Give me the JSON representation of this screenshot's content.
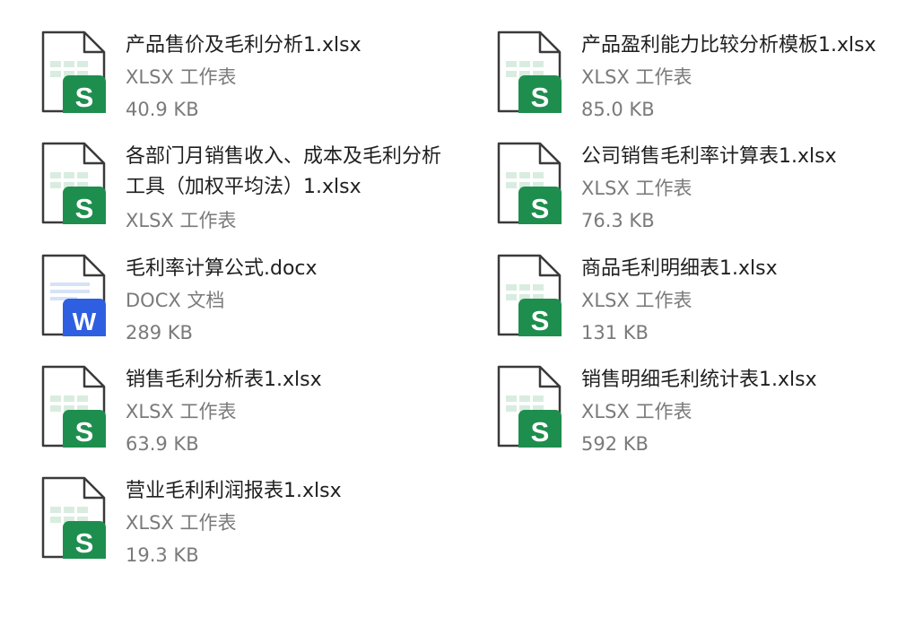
{
  "files": [
    {
      "name": "产品售价及毛利分析1.xlsx",
      "type": "XLSX 工作表",
      "size": "40.9 KB",
      "icon": "xlsx-sheet-icon",
      "badge": "S"
    },
    {
      "name": "产品盈利能力比较分析模板1.xlsx",
      "type": "XLSX 工作表",
      "size": "85.0 KB",
      "icon": "xlsx-sheet-icon",
      "badge": "S"
    },
    {
      "name": "各部门月销售收入、成本及毛利分析工具（加权平均法）1.xlsx",
      "type": "XLSX 工作表",
      "size": "",
      "icon": "xlsx-sheet-icon",
      "badge": "S"
    },
    {
      "name": "公司销售毛利率计算表1.xlsx",
      "type": "XLSX 工作表",
      "size": "76.3 KB",
      "icon": "xlsx-sheet-icon",
      "badge": "S"
    },
    {
      "name": "毛利率计算公式.docx",
      "type": "DOCX 文档",
      "size": "289 KB",
      "icon": "docx-document-icon",
      "badge": "W"
    },
    {
      "name": "商品毛利明细表1.xlsx",
      "type": "XLSX 工作表",
      "size": "131 KB",
      "icon": "xlsx-sheet-icon",
      "badge": "S"
    },
    {
      "name": "销售毛利分析表1.xlsx",
      "type": "XLSX 工作表",
      "size": "63.9 KB",
      "icon": "xlsx-sheet-icon",
      "badge": "S"
    },
    {
      "name": "销售明细毛利统计表1.xlsx",
      "type": "XLSX 工作表",
      "size": "592 KB",
      "icon": "xlsx-sheet-icon",
      "badge": "S"
    },
    {
      "name": "营业毛利利润报表1.xlsx",
      "type": "XLSX 工作表",
      "size": "19.3 KB",
      "icon": "xlsx-sheet-icon",
      "badge": "S"
    }
  ],
  "colors": {
    "sheet_badge": "#1e8e4e",
    "sheet_grid": "#d9ece0",
    "doc_badge": "#2d5fe0",
    "doc_lines": "#d6e2f7",
    "page_outline": "#3a3a3a",
    "name_text": "#1f1f1f",
    "meta_text": "#7a7a7a"
  }
}
